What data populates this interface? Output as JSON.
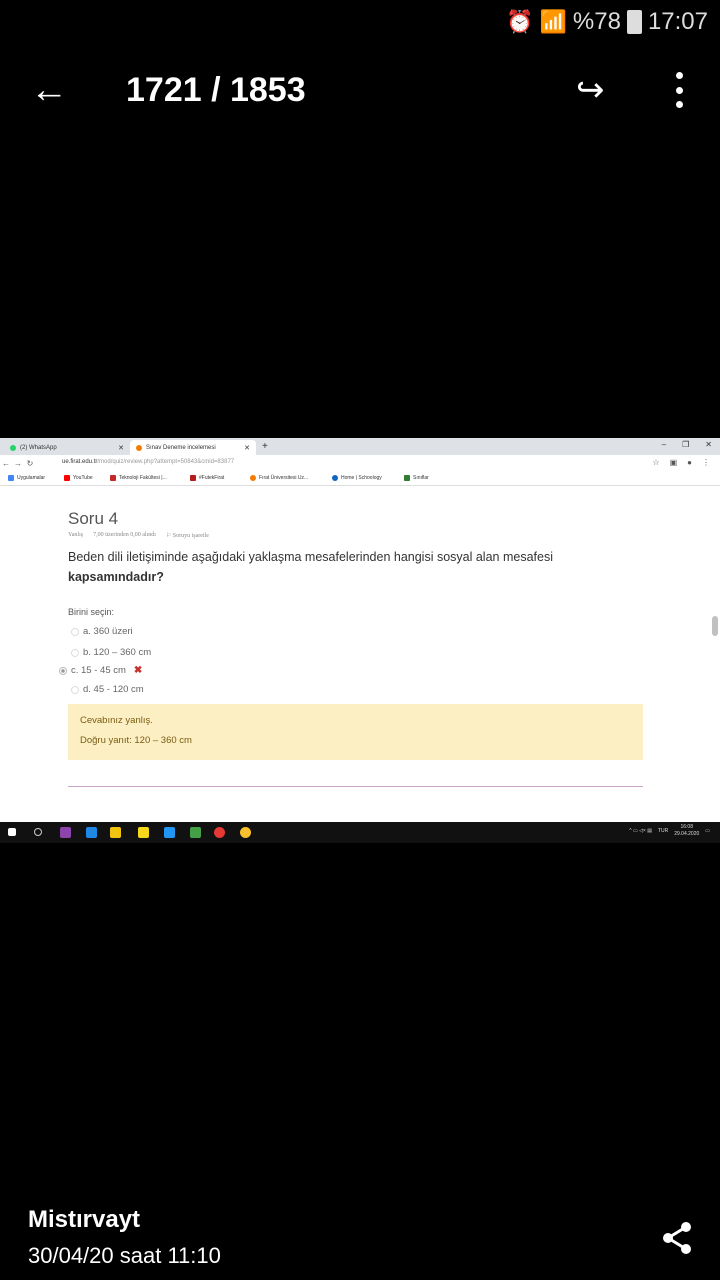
{
  "status_bar": {
    "battery_text": "%78",
    "time": "17:07"
  },
  "gallery": {
    "counter": "1721 / 1853",
    "sender": "Mistırvayt",
    "datetime": "30/04/20 saat 11:10"
  },
  "browser": {
    "tabs": [
      {
        "label": "(2) WhatsApp",
        "color": "#25d366"
      },
      {
        "label": "Sınav Deneme incelemesi",
        "color": "#f57c00"
      }
    ],
    "url_host": "ue.firat.edu.tr",
    "url_path": "/mod/quiz/review.php?attempt=50843&cmid=83877",
    "bookmarks": [
      {
        "label": "Uygulamalar",
        "color": "#4285f4"
      },
      {
        "label": "YouTube",
        "color": "#ff0000"
      },
      {
        "label": "Teknoloji Fakültesi |...",
        "color": "#c62828"
      },
      {
        "label": "#FutekFirat",
        "color": "#b71c1c"
      },
      {
        "label": "Fırat Üniversitesi Uz...",
        "color": "#f57c00"
      },
      {
        "label": "Home | Schoology",
        "color": "#1565c0"
      },
      {
        "label": "Sınıflar",
        "color": "#2e7d32"
      }
    ]
  },
  "quiz": {
    "title": "Soru 4",
    "status": "Yanlış",
    "score": "7,00 üzerinden 0,00 alındı",
    "flag": "Soruyu işaretle",
    "question_part1": "Beden dili iletişiminde aşağıdaki yaklaşma mesafelerinden hangisi sosyal alan mesafesi",
    "question_part2": "kapsamındadır?",
    "choose_label": "Birini seçin:",
    "options": [
      "a. 360 üzeri",
      "b. 120 – 360 cm",
      "c. 15 - 45 cm",
      "d. 45 - 120 cm"
    ],
    "selected_index": 2,
    "feedback_wrong": "Cevabınız yanlış.",
    "feedback_correct": "Doğru yanıt: 120 – 360 cm"
  },
  "taskbar": {
    "lang": "TUR",
    "time": "16:08",
    "date": "29.04.2020"
  },
  "colors": {
    "feedback_bg": "#fcefc4",
    "wrong": "#c9302c"
  }
}
